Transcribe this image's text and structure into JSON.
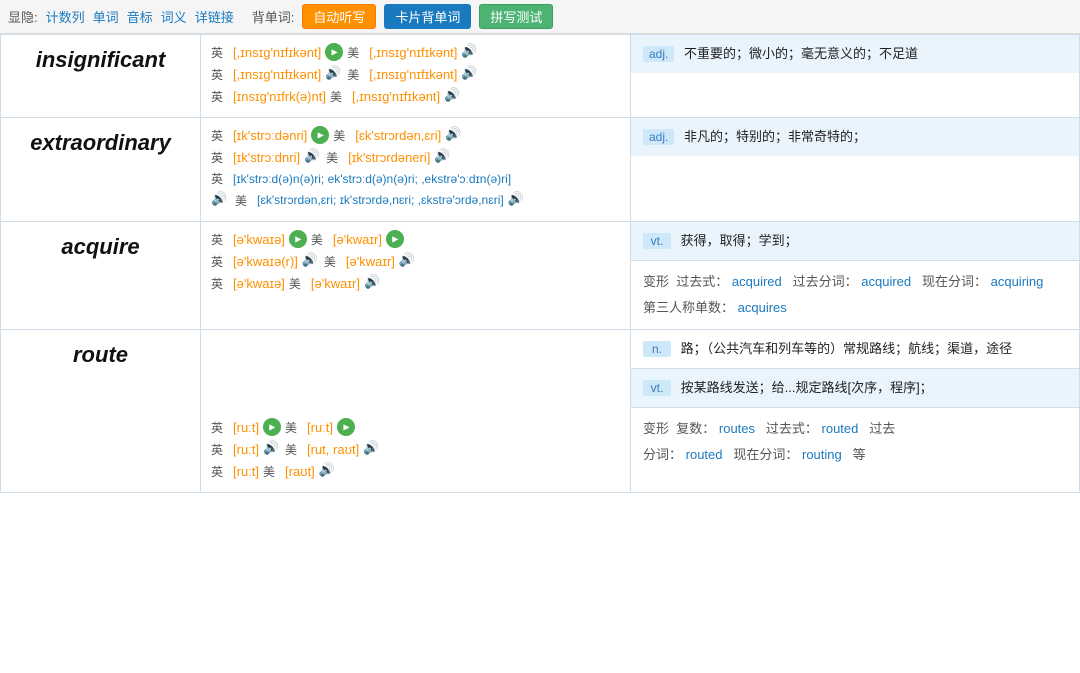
{
  "toolbar": {
    "hide_label": "显隐:",
    "count_col": "计数列",
    "word": "单词",
    "phonetic": "音标",
    "meaning": "词义",
    "detail_link": "详链接",
    "back_word_label": "背单词:",
    "btn_auto_listen": "自动听写",
    "btn_card_back": "卡片背单词",
    "btn_pinyin": "拼写测试"
  },
  "words": [
    {
      "word": "insignificant",
      "phonetics": [
        {
          "lang": "英",
          "text": "[,ɪnsɪɡ'nɪfɪkənt]",
          "has_green_btn": true,
          "us_text": "[,ɪnsɪɡ'nɪfɪkənt]",
          "has_blue_btn": true
        },
        {
          "lang": "英",
          "text": "[,ɪnsɪɡ'nɪfɪkənt]",
          "has_green_btn": false,
          "has_blue_small": true,
          "us_text": "[,ɪnsɪɡ'nɪfɪkənt]",
          "has_blue_btn": true
        },
        {
          "lang": "英",
          "text": "[ɪnsɪɡ'nɪfrk(ə)nt]",
          "has_green_btn": false,
          "us_text": "[,ɪnsɪɡ'nɪfɪkənt]",
          "has_blue_btn_small": true
        }
      ],
      "definitions": [
        {
          "pos": "adj.",
          "text": "不重要的；微小的；毫无意义的；不足道",
          "shaded": true
        }
      ]
    },
    {
      "word": "extraordinary",
      "phonetics": [
        {
          "lang": "英",
          "text": "[ɪk'strɔːdənri]",
          "has_green_btn": true,
          "us_text": "[ɛk'strɔrdən,ɛri]",
          "has_blue_btn": true
        },
        {
          "lang": "英",
          "text": "[ɪk'strɔːdnri]",
          "has_green_btn": false,
          "has_blue_small": true,
          "us_text": "[ɪk'strɔrdəneri]",
          "has_blue_btn_small": true
        },
        {
          "lang": "英",
          "text": "[ɪk'strɔːd(ə)n(ə)ri; ek'strɔːd(ə)n(ə)ri; ,ekstrə'ɔːdɪn(ə)ri]",
          "extra": true
        },
        {
          "lang": "",
          "text": "[ɛk'strɔrdən,ɛri; ɪk'strɔrdə,nɛri; ,ɛkstrə'ɔrdə,nɛri]",
          "extra2": true
        }
      ],
      "definitions": [
        {
          "pos": "adj.",
          "text": "非凡的；特别的；非常奇特的；",
          "shaded": true
        }
      ]
    },
    {
      "word": "acquire",
      "phonetics": [
        {
          "lang": "英",
          "text": "[ə'kwaɪə]",
          "has_green_btn": true,
          "us_text": "[ə'kwaɪr]",
          "has_blue_btn_green": true
        },
        {
          "lang": "英",
          "text": "[ə'kwaɪə(r)]",
          "has_green_btn": false,
          "has_blue_small": true,
          "us_text": "[ə'kwaɪr]",
          "has_blue_btn": true
        },
        {
          "lang": "英",
          "text": "[ə'kwaɪə]",
          "has_green_btn": false,
          "us_text": "[ə'kwaɪr]",
          "has_blue_btn_only": true
        }
      ],
      "definitions": [
        {
          "pos": "vt.",
          "text": "获得，取得；学到；",
          "shaded": false
        },
        {
          "pos": "",
          "morph": true,
          "morph_label": "变形",
          "past": "acquired",
          "past_participle": "acquired",
          "present_participle": "acquiring",
          "third": "acquires",
          "shaded": false
        }
      ]
    },
    {
      "word": "route",
      "phonetics": [
        {
          "lang": "英",
          "text": "[ruːt]",
          "has_green_btn": true,
          "us_text": "[ruːt]",
          "has_blue_btn_green": true
        },
        {
          "lang": "英",
          "text": "[ruːt]",
          "has_green_btn": false,
          "has_blue_small": true,
          "us_text": "[rut, raʊt]",
          "has_blue_btn": true
        },
        {
          "lang": "英",
          "text": "[ruːt]",
          "has_green_btn": false,
          "us_text": "[raʊt]",
          "has_blue_btn_only": true
        }
      ],
      "definitions": [
        {
          "pos": "n.",
          "text": "路；（公共汽车和列车等的）常规路线；航线；渠道，途径",
          "shaded": false
        },
        {
          "pos": "vt.",
          "text": "按某路线发送；给...规定路线[次序，程序]；",
          "shaded": false
        },
        {
          "pos": "",
          "morph": true,
          "morph_label": "变形",
          "plural": "routes",
          "past": "routed",
          "past_participle_label": "过去分词:",
          "past_participle": "routed",
          "present_participle_label": "现在分词:",
          "present_participle": "routing",
          "etc": "等",
          "shaded": false
        }
      ]
    }
  ]
}
